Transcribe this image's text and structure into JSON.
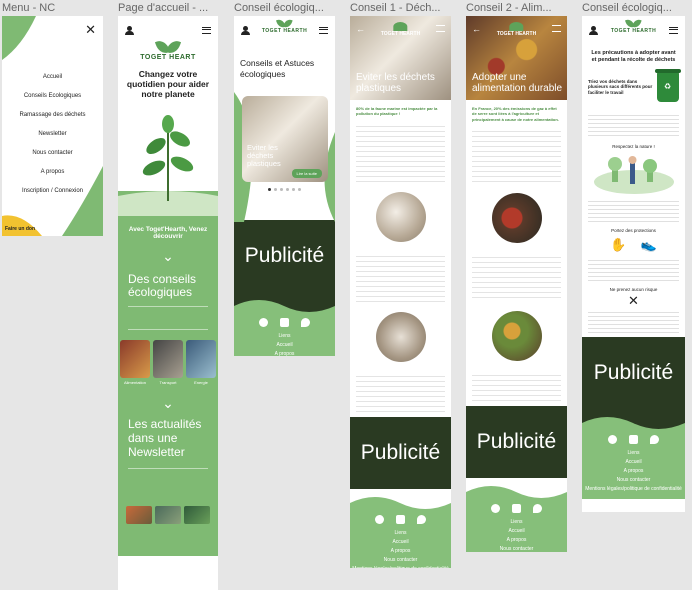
{
  "frames": {
    "menu": {
      "label": "Menu - NC",
      "items": [
        "Accueil",
        "Conseils Ecologiques",
        "Ramassage des déchets",
        "Newsletter",
        "Nous contacter",
        "A propos",
        "Inscription / Connexion"
      ],
      "donate": "Faire un don"
    },
    "home": {
      "label": "Page d'accueil - ...",
      "tagline": "Changez votre quotidien pour aider notre planete",
      "discover": "Avec Toget'Hearth, Venez découvrir",
      "section1": "Des conseils écologiques",
      "categories": [
        "Alimentation",
        "Transport",
        "Energie"
      ],
      "section2": "Les actualités dans une Newsletter"
    },
    "conseils": {
      "label": "Conseil écologiq...",
      "title": "Conseils et Astuces écologiques",
      "card_title": "Eviter les déchets plastiques",
      "card_button": "Lire la suite",
      "pub": "Publicité"
    },
    "conseil1": {
      "label": "Conseil 1 - Déch...",
      "hero_title": "Eviter les déchets plastiques",
      "intro": "80% de la faune marine est impactée par la pollution du plastique !",
      "pub": "Publicité"
    },
    "conseil2": {
      "label": "Conseil 2 - Alim...",
      "hero_title": "Adopter une alimentation durable",
      "intro": "En France, 20% des émissions de gaz à effet de serre sont liées à l'agriculture et principalement à cause de notre alimentation.",
      "pub": "Publicité"
    },
    "conseil3": {
      "label": "Conseil écologiq...",
      "title": "Les précautions à adopter avant et pendant la récolte de déchets",
      "sub": "Triez vos déchets dans plusieurs sacs différents pour faciliter le travail",
      "respect": "Respectez la nature !",
      "protect": "Portez des protections",
      "no_risk": "Ne prenez aucun risque",
      "pub": "Publicité"
    },
    "footer": {
      "links": [
        "Liens",
        "Accueil",
        "A propos",
        "Nous contacter"
      ],
      "legal": "Mentions légales/politique de confidentialité"
    },
    "colors": {
      "green": "#7fba73",
      "dark": "#2a3a22"
    }
  }
}
